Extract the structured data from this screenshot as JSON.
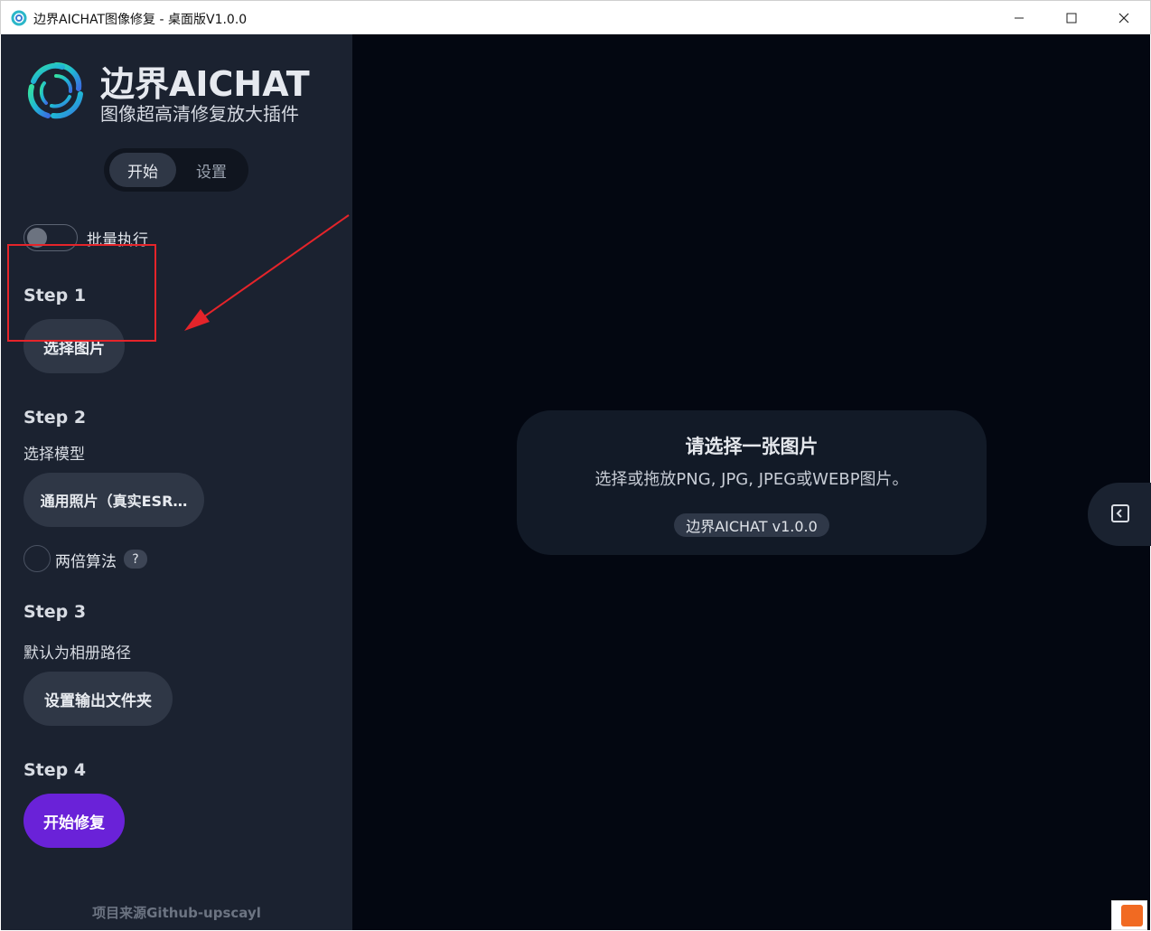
{
  "window": {
    "title": "边界AICHAT图像修复 - 桌面版V1.0.0",
    "minimize_glyph": "—",
    "maximize_glyph": "☐",
    "close_glyph": "✕"
  },
  "brand": {
    "title": "边界AICHAT",
    "subtitle": "图像超高清修复放大插件"
  },
  "tabs": [
    {
      "label": "开始",
      "active": true
    },
    {
      "label": "设置",
      "active": false
    }
  ],
  "batch": {
    "label": "批量执行",
    "enabled": false
  },
  "steps": [
    {
      "title": "Step 1",
      "button": "选择图片"
    },
    {
      "title": "Step 2",
      "desc": "选择模型",
      "button": "通用照片（真实ESR…"
    },
    {
      "title": "Step 3",
      "desc": "默认为相册路径",
      "button": "设置输出文件夹"
    },
    {
      "title": "Step 4",
      "button": "开始修复"
    }
  ],
  "double_algo": {
    "label": "两倍算法",
    "help": "?",
    "checked": false
  },
  "footer": "项目来源Github-upscayl",
  "main": {
    "card_title": "请选择一张图片",
    "card_desc": "选择或拖放PNG, JPG, JPEG或WEBP图片。",
    "version": "边界AICHAT v1.0.0"
  },
  "colors": {
    "sidebar_bg": "#1b2230",
    "main_bg": "#030711",
    "accent": "#6a22d8",
    "annotation": "#e5242a"
  }
}
